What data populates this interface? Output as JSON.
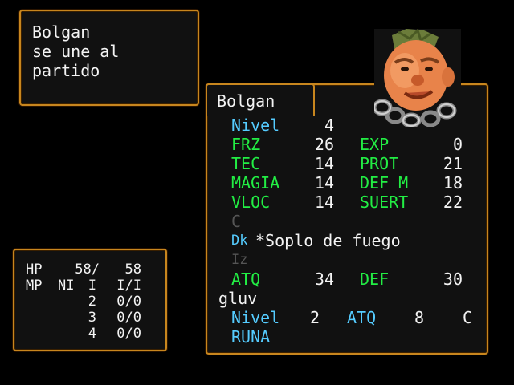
{
  "message": {
    "line1": "Bolgan",
    "line2": "se une al",
    "line3": "partido"
  },
  "character": {
    "name": "Bolgan",
    "portrait_icon": "dwarf-portrait"
  },
  "stats": {
    "nivel_label": "Nivel",
    "nivel": "4",
    "frz_label": "FRZ",
    "frz": "26",
    "exp_label": "EXP",
    "exp": "0",
    "tec_label": "TEC",
    "tec": "14",
    "prot_label": "PROT",
    "prot": "21",
    "magia_label": "MAGIA",
    "magia": "14",
    "defm_label": "DEF M",
    "defm": "18",
    "vloc_label": "VLOC",
    "vloc": "14",
    "suert_label": "SUERT",
    "suert": "22"
  },
  "equipment": {
    "slot1": "C",
    "slot2_icon": "Dk",
    "slot2": "*Soplo de fuego",
    "slot3": "Iz"
  },
  "combat": {
    "atq_label": "ATQ",
    "atq": "34",
    "def_label": "DEF",
    "def": "30"
  },
  "weapon": {
    "name": "gluv",
    "nivel_label": "Nivel",
    "nivel": "2",
    "atq_label": "ATQ",
    "atq": "8",
    "grade": "C",
    "runa_label": "RUNA"
  },
  "status": {
    "hp_label": "HP",
    "hp_cur": "58/",
    "hp_max": "58",
    "mp_label": "MP",
    "mp_lvl_label": "NI",
    "mp_lvl1": "I",
    "mp_val1": "I/I",
    "mp_lvl2": "2",
    "mp_val2": "0/0",
    "mp_lvl3": "3",
    "mp_val3": "0/0",
    "mp_lvl4": "4",
    "mp_val4": "0/0"
  }
}
